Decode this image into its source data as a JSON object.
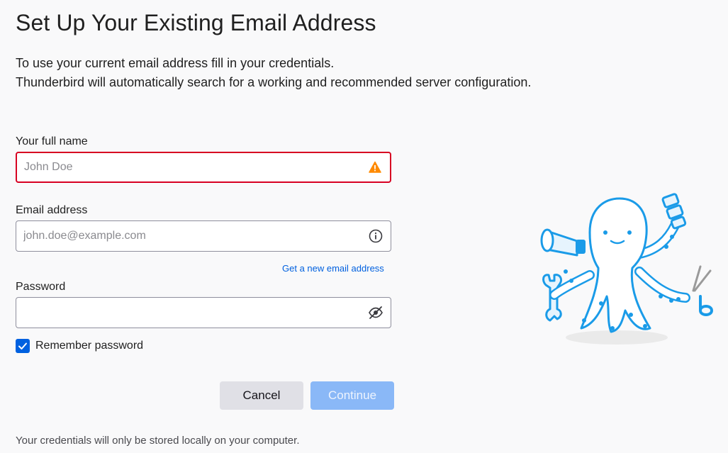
{
  "header": {
    "title": "Set Up Your Existing Email Address"
  },
  "intro": {
    "line1": "To use your current email address fill in your credentials.",
    "line2": "Thunderbird will automatically search for a working and recommended server configuration."
  },
  "form": {
    "full_name": {
      "label": "Your full name",
      "placeholder": "John Doe",
      "value": "",
      "icon": "warning-icon"
    },
    "email": {
      "label": "Email address",
      "placeholder": "john.doe@example.com",
      "value": "",
      "icon": "info-icon"
    },
    "new_address_link": "Get a new email address",
    "password": {
      "label": "Password",
      "placeholder": "",
      "value": "",
      "icon": "eye-slash-icon"
    },
    "remember_password": {
      "label": "Remember password",
      "checked": true
    }
  },
  "buttons": {
    "cancel": "Cancel",
    "continue": "Continue"
  },
  "footer": {
    "note": "Your credentials will only be stored locally on your computer."
  },
  "colors": {
    "accent": "#0061e0",
    "error_border": "#d70022",
    "warning": "#ff8a00",
    "continue_disabled": "#8ab8f7",
    "illustration_blue": "#1a9be8"
  }
}
